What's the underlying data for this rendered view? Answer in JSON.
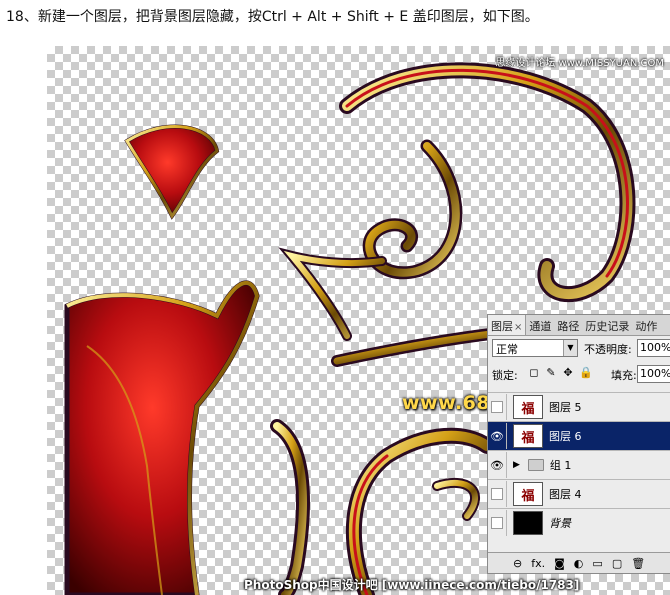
{
  "instruction": "18、新建一个图层，把背景图层隐藏，按Ctrl + Alt + Shift + E 盖印图层，如下图。",
  "watermarks": {
    "top": "思缘设计论坛 www.MISSYUAN.COM",
    "site": "www.68ps.com",
    "bottom": "PhotoShop中国设计吧 [www.iinece.com/tiebo/1783]"
  },
  "colors": {
    "panel_bg": "#ececec",
    "selected_row": "#0a2468",
    "gold": "#d4a017",
    "red": "#c8101a"
  },
  "layers_panel": {
    "tabs": [
      {
        "label": "图层",
        "close": "×"
      },
      {
        "label": "通道"
      },
      {
        "label": "路径"
      },
      {
        "label": "历史记录"
      },
      {
        "label": "动作"
      }
    ],
    "blend_mode": "正常",
    "opacity_label": "不透明度:",
    "opacity_value": "100%",
    "lock_label": "锁定:",
    "fill_label": "填充:",
    "fill_value": "100%",
    "layers": [
      {
        "name": "图层 5",
        "visible": false,
        "thumb": "福",
        "selected": false
      },
      {
        "name": "图层 6",
        "visible": true,
        "thumb": "福",
        "selected": true
      },
      {
        "name": "组 1",
        "visible": true,
        "group": true,
        "selected": false
      },
      {
        "name": "图层 4",
        "visible": false,
        "thumb": "福",
        "selected": false
      },
      {
        "name": "背景",
        "visible": false,
        "thumb": "",
        "background": true,
        "selected": false
      }
    ],
    "footer_icons": [
      "link-icon",
      "fx-icon",
      "mask-icon",
      "adjustment-icon",
      "folder-icon",
      "new-layer-icon",
      "trash-icon"
    ],
    "footer_fx": "fx."
  }
}
